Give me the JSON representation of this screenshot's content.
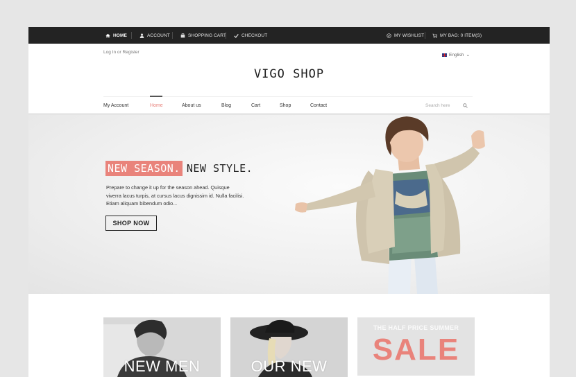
{
  "topbar": {
    "home": "HOME",
    "account": "ACCOUNT",
    "cart": "SHOPPING CART",
    "checkout": "CHECKOUT",
    "wishlist": "MY WISHLIST",
    "bag": "MY BAG: 0 ITEM(S)"
  },
  "header": {
    "login": "Log In or Register",
    "language": "English",
    "logo": "VIGO SHOP"
  },
  "nav": {
    "items": [
      "My Account",
      "Home",
      "About us",
      "Blog",
      "Cart",
      "Shop",
      "Contact"
    ],
    "active": "Home",
    "search_placeholder": "Search here"
  },
  "hero": {
    "headline_accent": "NEW SEASON.",
    "headline_rest": "NEW STYLE.",
    "text": "Prepare to change it up for the season ahead. Quisque viverra lacus turpis, at cursus lacus dignissim id. Nulla facilisi. Etiam aliquam bibendum odio...",
    "button": "SHOP NOW"
  },
  "promos": {
    "men": "NEW MEN",
    "new": "OUR NEW",
    "sale_sub": "THE HALF PRICE SUMMER",
    "sale_big": "SALE"
  },
  "colors": {
    "accent": "#e9837b",
    "topbar": "#232323"
  }
}
